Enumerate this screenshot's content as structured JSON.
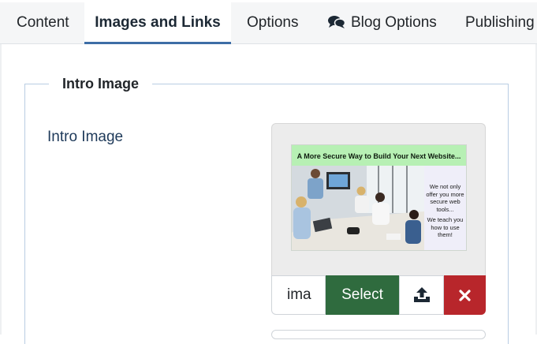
{
  "tabs": [
    {
      "label": "Content",
      "active": false
    },
    {
      "label": "Images and Links",
      "active": true
    },
    {
      "label": "Options",
      "active": false
    },
    {
      "label": "Blog Options",
      "active": false,
      "icon": "comments-icon"
    },
    {
      "label": "Publishing",
      "active": false
    }
  ],
  "fieldset": {
    "legend": "Intro Image"
  },
  "intro_image": {
    "label": "Intro Image",
    "value": "ima",
    "select_label": "Select",
    "upload_icon": "upload-icon",
    "clear_icon": "close-icon",
    "preview": {
      "banner": "A More Secure Way to Build Your Next Website...",
      "side_text_1": "We not only offer you more secure web tools...",
      "side_text_2": "We teach you how to use them!"
    }
  },
  "colors": {
    "accent": "#3d6ea6",
    "select_button": "#2f6b3e",
    "clear_button": "#b8262b",
    "label_text": "#1f3a5a"
  }
}
